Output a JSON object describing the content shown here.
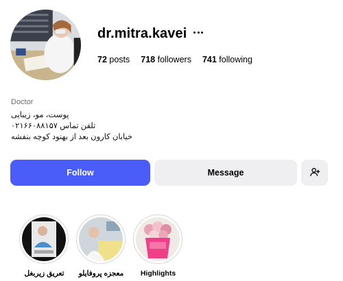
{
  "profile": {
    "username": "dr.mitra.kavei",
    "posts_count": "72",
    "posts_label": "posts",
    "followers_count": "718",
    "followers_label": "followers",
    "following_count": "741",
    "following_label": "following",
    "category": "Doctor",
    "bio_line1": "پوست، مو، زیبایی",
    "bio_line2": "تلفن تماس ۰۲۱۶۶۰۸۸۱۵۷",
    "bio_line3": "خیابان کارون بعد از بهنود کوچه بنفشه"
  },
  "actions": {
    "follow_label": "Follow",
    "message_label": "Message",
    "add_user_icon": "add-user-icon"
  },
  "highlights": [
    {
      "label": "تعریق زیربغل"
    },
    {
      "label": "معجزه پروفایلو"
    },
    {
      "label": "Highlights"
    }
  ],
  "colors": {
    "follow_button": "#4a5df9",
    "secondary_button": "#efeff1",
    "muted_text": "#6b6b6b"
  }
}
